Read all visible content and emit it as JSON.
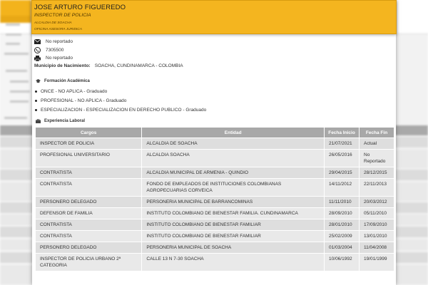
{
  "profile": {
    "name": "JOSE ARTURO FIGUEREDO",
    "title": "INSPECTOR DE POLICIA",
    "entity": "ALCALDIA DE SOACHA",
    "office": "OFICINA ASESORA JURIDICA"
  },
  "contact": {
    "email": "No reportado",
    "phone": "7305500",
    "fax": "No reportado"
  },
  "birth": {
    "label": "Municipio de Nacimiento:",
    "value": "SOACHA, CUNDINAMARCA - COLOMBIA"
  },
  "education": {
    "title": "Formación Académica",
    "items": [
      "ONCE - NO APLICA - Graduado",
      "PROFESIONAL - NO APLICA - Graduado",
      "ESPECIALIZACION - ESPECIALIZACION EN DERECHO PUBLICO - Graduado"
    ]
  },
  "experience": {
    "title": "Experiencia Laboral",
    "headers": [
      "Cargos",
      "Entidad",
      "Fecha Inicio",
      "Fecha Fin"
    ],
    "rows": [
      [
        "INSPECTOR DE POLICIA",
        "ALCALDIA DE SOACHA",
        "21/07/2021",
        "Actual"
      ],
      [
        "PROFESIONAL UNIVERSITARIO",
        "ALCALDIA SOACHA",
        "26/05/2016",
        "No Reportado"
      ],
      [
        "CONTRATISTA",
        "ALCALDIA MUNICIPAL DE ARMENIA - QUINDIO",
        "29/04/2015",
        "28/12/2015"
      ],
      [
        "CONTRATISTA",
        "FONDO DE EMPLEADOS DE INSTITUCIONES COLOMBIANAS AGROPECUARIAS CORVEICA",
        "14/11/2012",
        "22/11/2013"
      ],
      [
        "PERSONERO DELEGADO",
        "PERSONERIA MUNICIPAL DE BARRANCOMINAS",
        "11/11/2010",
        "20/03/2012"
      ],
      [
        "DEFENSOR DE FAMILIA",
        "INSTITUTO COLOMBIANO DE BIENESTAR FAMILIA. CUNDINAMARCA",
        "28/09/2010",
        "05/11/2010"
      ],
      [
        "CONTRATISTA",
        "INSTITUTO COLOMBIANO DE BIENESTAR FAMILIAR",
        "28/01/2010",
        "17/09/2010"
      ],
      [
        "CONTRATISTA",
        "INSTITUTO COLOMBIANO DE BIENESTAR FAMILIAR",
        "25/02/2009",
        "13/01/2010"
      ],
      [
        "PERSONERO DELEGADO",
        "PERSONERIA MUNICIPAL DE SOACHA",
        "01/03/2004",
        "11/04/2008"
      ],
      [
        "INSPECTOR DE POLICIA URBANO 2ª CATEGORIA",
        "CALLE 13 N 7-30 SOACHA",
        "10/06/1992",
        "19/01/1999"
      ]
    ]
  },
  "colors": {
    "header_bg": "#f4b51f",
    "table_head": "#a8a8a8",
    "row": "#dedede",
    "row_alt": "#e9e9e9"
  }
}
